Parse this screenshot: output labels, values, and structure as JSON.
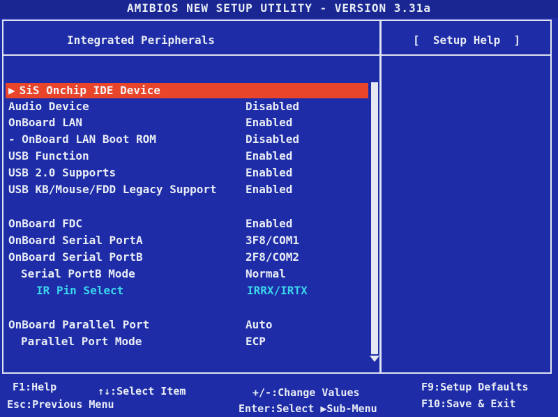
{
  "title": "AMIBIOS NEW SETUP UTILITY - VERSION 3.31a",
  "header": {
    "section": "Integrated Peripherals",
    "help": "[  Setup Help  ]"
  },
  "rows": [
    {
      "label": "SiS Onchip IDE Device",
      "value": "",
      "selected": true,
      "submenu": true
    },
    {
      "label": "Audio Device",
      "value": "Disabled"
    },
    {
      "label": "OnBoard LAN",
      "value": "Enabled"
    },
    {
      "label": "- OnBoard LAN Boot ROM",
      "value": "Disabled"
    },
    {
      "label": "USB Function",
      "value": "Enabled"
    },
    {
      "label": "USB 2.0 Supports",
      "value": "Enabled"
    },
    {
      "label": "USB KB/Mouse/FDD Legacy Support",
      "value": "Enabled"
    },
    {
      "label": "OnBoard FDC",
      "value": "Enabled"
    },
    {
      "label": "OnBoard Serial PortA",
      "value": "3F8/COM1"
    },
    {
      "label": "OnBoard Serial PortB",
      "value": "2F8/COM2"
    },
    {
      "label": "Serial PortB Mode",
      "value": "Normal"
    },
    {
      "label": "IR Pin Select",
      "value": "IRRX/IRTX",
      "cyan": true
    },
    {
      "label": "OnBoard Parallel Port",
      "value": "Auto"
    },
    {
      "label": "Parallel Port Mode",
      "value": "ECP"
    }
  ],
  "footer": {
    "f1": "F1:Help",
    "select_item": "↑↓:Select Item",
    "change_values": "+/-:Change Values",
    "f9": "F9:Setup Defaults",
    "esc": "Esc:Previous Menu",
    "enter": "Enter:Select ▶Sub-Menu",
    "f10": "F10:Save & Exit"
  },
  "colors": {
    "background": "#1e2ca8",
    "highlight": "#e8452a",
    "text": "#e8ecf4",
    "disabled_item": "#3bd6ea"
  }
}
